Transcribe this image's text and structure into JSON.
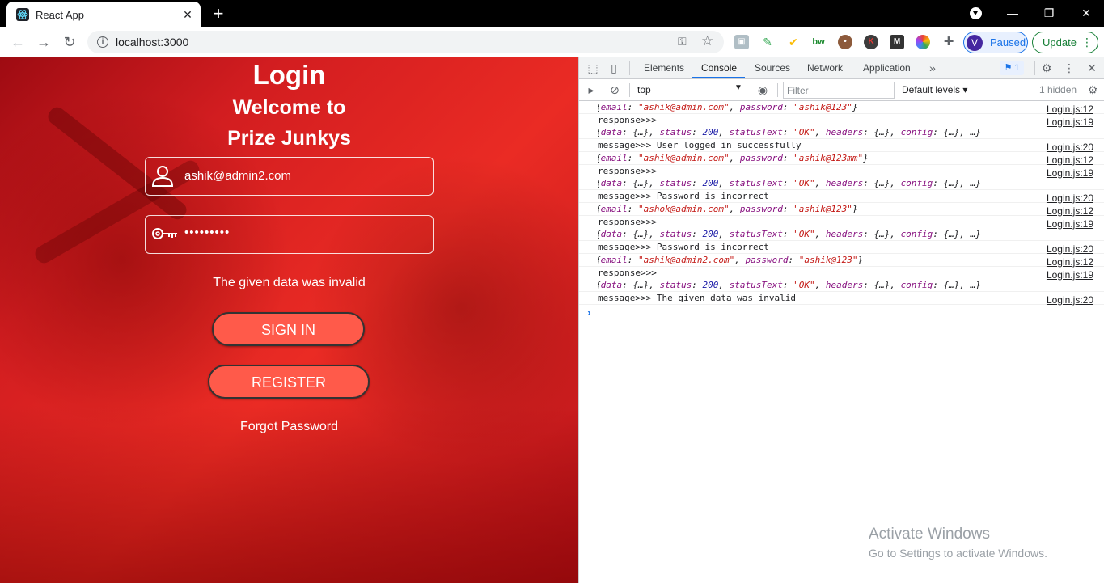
{
  "browser": {
    "tab_title": "React App",
    "url": "localhost:3000",
    "profile_status": "Paused",
    "profile_initial": "V",
    "update_label": "Update",
    "extensions": [
      "user-avatar",
      "leaf",
      "check-circle",
      "bw",
      "cookie",
      "K",
      "M",
      "color-wheel",
      "puzzle"
    ]
  },
  "app": {
    "heading": "Login",
    "welcome_line1": "Welcome to",
    "welcome_line2": "Prize Junkys",
    "email_value": "ashik@admin2.com",
    "password_mask": "•••••••••",
    "error_message": "The given data was invalid",
    "signin_label": "SIGN IN",
    "register_label": "REGISTER",
    "forgot_label": "Forgot Password",
    "colors": {
      "button": "#ff5a4a",
      "background": "#e02522"
    }
  },
  "devtools": {
    "tabs": [
      "Elements",
      "Console",
      "Sources",
      "Network",
      "Application"
    ],
    "active_tab": "Console",
    "issues_count": "1",
    "context": "top",
    "filter_placeholder": "Filter",
    "levels": "Default levels",
    "hidden": "1 hidden",
    "logs": [
      {
        "parts": [
          [
            "p",
            "{"
          ],
          [
            "k",
            "email"
          ],
          [
            "p",
            ": "
          ],
          [
            "s",
            "\"ashik@admin.com\""
          ],
          [
            "p",
            ", "
          ],
          [
            "k",
            "password"
          ],
          [
            "p",
            ": "
          ],
          [
            "s",
            "\"ashik@123\""
          ],
          [
            "p",
            "}"
          ]
        ],
        "expand": true,
        "source": "Login.js:12"
      },
      {
        "label": "response>>>",
        "parts": [
          [
            "p",
            "{"
          ],
          [
            "k",
            "data"
          ],
          [
            "p",
            ": {…}, "
          ],
          [
            "k",
            "status"
          ],
          [
            "p",
            ": "
          ],
          [
            "n",
            "200"
          ],
          [
            "p",
            ", "
          ],
          [
            "k",
            "statusText"
          ],
          [
            "p",
            ": "
          ],
          [
            "s",
            "\"OK\""
          ],
          [
            "p",
            ", "
          ],
          [
            "k",
            "headers"
          ],
          [
            "p",
            ": {…}, "
          ],
          [
            "k",
            "config"
          ],
          [
            "p",
            ": {…}, …}"
          ]
        ],
        "expand": true,
        "source": "Login.js:19"
      },
      {
        "label": "message>>> User logged in successfully",
        "source": "Login.js:20"
      },
      {
        "parts": [
          [
            "p",
            "{"
          ],
          [
            "k",
            "email"
          ],
          [
            "p",
            ": "
          ],
          [
            "s",
            "\"ashik@admin.com\""
          ],
          [
            "p",
            ", "
          ],
          [
            "k",
            "password"
          ],
          [
            "p",
            ": "
          ],
          [
            "s",
            "\"ashik@123mm\""
          ],
          [
            "p",
            "}"
          ]
        ],
        "expand": true,
        "source": "Login.js:12"
      },
      {
        "label": "response>>>",
        "parts": [
          [
            "p",
            "{"
          ],
          [
            "k",
            "data"
          ],
          [
            "p",
            ": {…}, "
          ],
          [
            "k",
            "status"
          ],
          [
            "p",
            ": "
          ],
          [
            "n",
            "200"
          ],
          [
            "p",
            ", "
          ],
          [
            "k",
            "statusText"
          ],
          [
            "p",
            ": "
          ],
          [
            "s",
            "\"OK\""
          ],
          [
            "p",
            ", "
          ],
          [
            "k",
            "headers"
          ],
          [
            "p",
            ": {…}, "
          ],
          [
            "k",
            "config"
          ],
          [
            "p",
            ": {…}, …}"
          ]
        ],
        "expand": true,
        "source": "Login.js:19"
      },
      {
        "label": "message>>> Password is incorrect",
        "source": "Login.js:20"
      },
      {
        "parts": [
          [
            "p",
            "{"
          ],
          [
            "k",
            "email"
          ],
          [
            "p",
            ": "
          ],
          [
            "s",
            "\"ashok@admin.com\""
          ],
          [
            "p",
            ", "
          ],
          [
            "k",
            "password"
          ],
          [
            "p",
            ": "
          ],
          [
            "s",
            "\"ashik@123\""
          ],
          [
            "p",
            "}"
          ]
        ],
        "expand": true,
        "source": "Login.js:12"
      },
      {
        "label": "response>>>",
        "parts": [
          [
            "p",
            "{"
          ],
          [
            "k",
            "data"
          ],
          [
            "p",
            ": {…}, "
          ],
          [
            "k",
            "status"
          ],
          [
            "p",
            ": "
          ],
          [
            "n",
            "200"
          ],
          [
            "p",
            ", "
          ],
          [
            "k",
            "statusText"
          ],
          [
            "p",
            ": "
          ],
          [
            "s",
            "\"OK\""
          ],
          [
            "p",
            ", "
          ],
          [
            "k",
            "headers"
          ],
          [
            "p",
            ": {…}, "
          ],
          [
            "k",
            "config"
          ],
          [
            "p",
            ": {…}, …}"
          ]
        ],
        "expand": true,
        "source": "Login.js:19"
      },
      {
        "label": "message>>> Password is incorrect",
        "source": "Login.js:20"
      },
      {
        "parts": [
          [
            "p",
            "{"
          ],
          [
            "k",
            "email"
          ],
          [
            "p",
            ": "
          ],
          [
            "s",
            "\"ashik@admin2.com\""
          ],
          [
            "p",
            ", "
          ],
          [
            "k",
            "password"
          ],
          [
            "p",
            ": "
          ],
          [
            "s",
            "\"ashik@123\""
          ],
          [
            "p",
            "}"
          ]
        ],
        "expand": true,
        "source": "Login.js:12"
      },
      {
        "label": "response>>>",
        "parts": [
          [
            "p",
            "{"
          ],
          [
            "k",
            "data"
          ],
          [
            "p",
            ": {…}, "
          ],
          [
            "k",
            "status"
          ],
          [
            "p",
            ": "
          ],
          [
            "n",
            "200"
          ],
          [
            "p",
            ", "
          ],
          [
            "k",
            "statusText"
          ],
          [
            "p",
            ": "
          ],
          [
            "s",
            "\"OK\""
          ],
          [
            "p",
            ", "
          ],
          [
            "k",
            "headers"
          ],
          [
            "p",
            ": {…}, "
          ],
          [
            "k",
            "config"
          ],
          [
            "p",
            ": {…}, …}"
          ]
        ],
        "expand": true,
        "source": "Login.js:19"
      },
      {
        "label": "message>>> The given data was invalid",
        "source": "Login.js:20"
      }
    ]
  },
  "watermark": {
    "line1": "Activate Windows",
    "line2": "Go to Settings to activate Windows."
  }
}
